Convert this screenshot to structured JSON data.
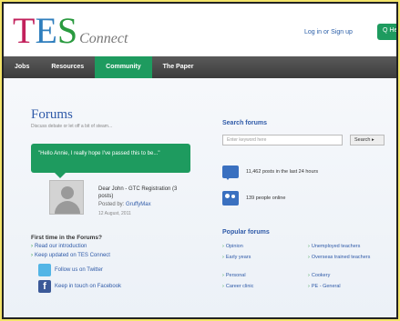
{
  "header": {
    "logo_main": "TES",
    "logo_t": "T",
    "logo_e": "E",
    "logo_s": "S",
    "logo_sub": "Connect",
    "login_text": "Log in or Sign up",
    "help_button": "Q Help"
  },
  "nav": {
    "items": [
      {
        "label": "Jobs"
      },
      {
        "label": "Resources"
      },
      {
        "label": "Community"
      },
      {
        "label": "The Paper"
      }
    ],
    "active": "Community"
  },
  "main": {
    "title": "Forums",
    "subtitle": "Discuss debate or let off a bit of steam...",
    "quote": "\"Hello Annie, I really hope I've passed this to be...\"",
    "post": {
      "title": "Dear John - GTC Registration (3 posts)",
      "by_prefix": "Posted by:",
      "author": "GruffyMax",
      "date": "12 August, 2011"
    },
    "first_time": {
      "heading": "First time in the Forums?",
      "links": [
        {
          "label": "Read our introduction"
        },
        {
          "label": "Keep updated on TES Connect"
        }
      ],
      "twitter": "Follow us on Twitter",
      "facebook": "Keep in touch on Facebook"
    }
  },
  "sidebar": {
    "search_title": "Search forums",
    "search_placeholder": "Enter keyword here",
    "search_button": "Search ▸",
    "stats": [
      {
        "text": "11,462 posts in the last 24 hours"
      },
      {
        "text": "139 people online"
      }
    ],
    "popular_title": "Popular forums",
    "popular": [
      {
        "label": "Opinion"
      },
      {
        "label": "Unemployed teachers"
      },
      {
        "label": "Early years"
      },
      {
        "label": "Overseas trained teachers"
      },
      {
        "label": "Personal"
      },
      {
        "label": "Cookery"
      },
      {
        "label": "Career clinic"
      },
      {
        "label": "PE - General"
      }
    ]
  },
  "colors": {
    "brand_green": "#1e9b5f",
    "link_blue": "#2f5aa8",
    "logo_red": "#c2215c",
    "logo_blue": "#2f7ebd",
    "logo_green": "#2a9a3f",
    "outer_border": "#f3e46b"
  },
  "icons": {
    "twitter": "twitter-icon",
    "facebook": "facebook-icon",
    "posts": "speech-bubble-icon",
    "people": "people-icon"
  }
}
